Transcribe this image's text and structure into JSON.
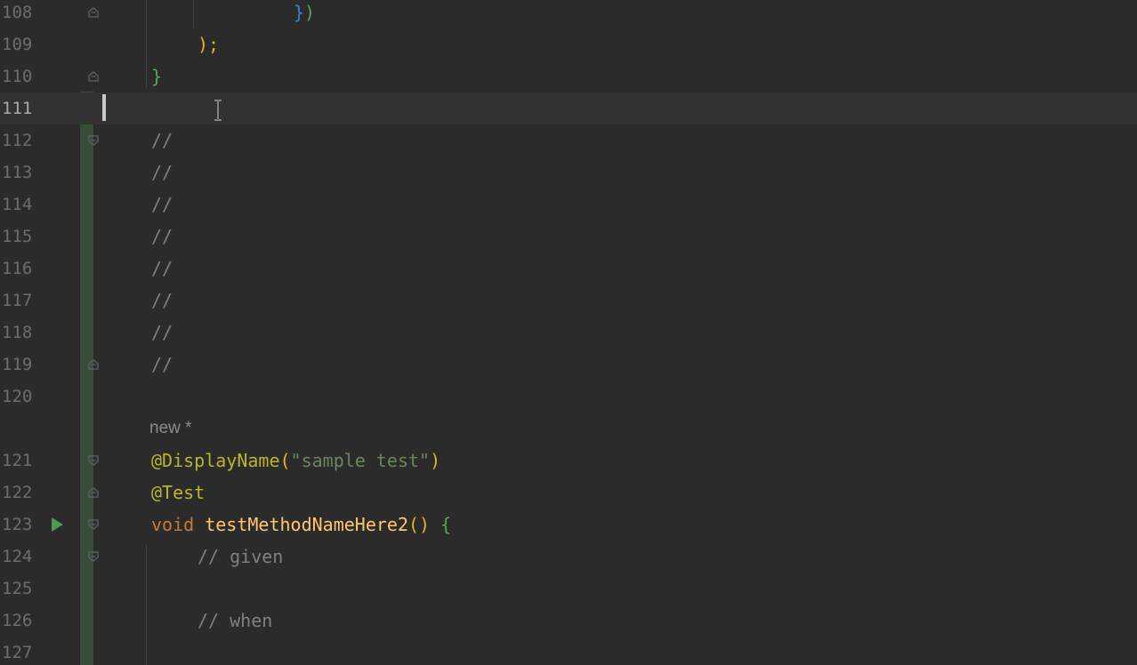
{
  "editor": {
    "lines": [
      {
        "num": "108",
        "tokens": [
          {
            "t": "}",
            "c": "c-brace-b"
          },
          {
            "t": ")",
            "c": "c-brace-g"
          }
        ],
        "indent": 330,
        "fold": "end"
      },
      {
        "num": "109",
        "tokens": [
          {
            "t": ");",
            "c": "c-paren-y"
          }
        ],
        "indent": 222,
        "fold": ""
      },
      {
        "num": "110",
        "tokens": [
          {
            "t": "}",
            "c": "c-brace-g"
          }
        ],
        "indent": 170,
        "fold": "end"
      },
      {
        "num": "111",
        "tokens": [],
        "indent": 170,
        "fold": "",
        "current": true
      },
      {
        "num": "112",
        "tokens": [
          {
            "t": "//",
            "c": "c-comment"
          }
        ],
        "indent": 170,
        "fold": "start"
      },
      {
        "num": "113",
        "tokens": [
          {
            "t": "//",
            "c": "c-comment"
          }
        ],
        "indent": 170,
        "fold": ""
      },
      {
        "num": "114",
        "tokens": [
          {
            "t": "//",
            "c": "c-comment"
          }
        ],
        "indent": 170,
        "fold": ""
      },
      {
        "num": "115",
        "tokens": [
          {
            "t": "//",
            "c": "c-comment"
          }
        ],
        "indent": 170,
        "fold": ""
      },
      {
        "num": "116",
        "tokens": [
          {
            "t": "//",
            "c": "c-comment"
          }
        ],
        "indent": 170,
        "fold": ""
      },
      {
        "num": "117",
        "tokens": [
          {
            "t": "//",
            "c": "c-comment"
          }
        ],
        "indent": 170,
        "fold": ""
      },
      {
        "num": "118",
        "tokens": [
          {
            "t": "//",
            "c": "c-comment"
          }
        ],
        "indent": 170,
        "fold": ""
      },
      {
        "num": "119",
        "tokens": [
          {
            "t": "//",
            "c": "c-comment"
          }
        ],
        "indent": 170,
        "fold": "end"
      },
      {
        "num": "120",
        "tokens": [],
        "indent": 170,
        "fold": ""
      },
      {
        "num": "121",
        "tokens": [
          {
            "t": "@DisplayName",
            "c": "c-anno"
          },
          {
            "t": "(",
            "c": "c-paren-y"
          },
          {
            "t": "\"sample test\"",
            "c": "c-string"
          },
          {
            "t": ")",
            "c": "c-paren-y"
          }
        ],
        "indent": 170,
        "fold": "start"
      },
      {
        "num": "122",
        "tokens": [
          {
            "t": "@Test",
            "c": "c-anno"
          }
        ],
        "indent": 170,
        "fold": "end"
      },
      {
        "num": "123",
        "tokens": [
          {
            "t": "void ",
            "c": "c-kw"
          },
          {
            "t": "testMethodNameHere2",
            "c": "c-method"
          },
          {
            "t": "() ",
            "c": "c-paren-y"
          },
          {
            "t": "{",
            "c": "c-brace-g"
          }
        ],
        "indent": 170,
        "fold": "start",
        "run": true
      },
      {
        "num": "124",
        "tokens": [
          {
            "t": "// given",
            "c": "c-comment"
          }
        ],
        "indent": 222,
        "fold": "start"
      },
      {
        "num": "125",
        "tokens": [],
        "indent": 222,
        "fold": ""
      },
      {
        "num": "126",
        "tokens": [
          {
            "t": "// when",
            "c": "c-comment"
          }
        ],
        "indent": 222,
        "fold": ""
      },
      {
        "num": "127",
        "tokens": [],
        "indent": 222,
        "fold": ""
      }
    ],
    "inlay_hint": "new *"
  },
  "icons": {
    "run": "run-test-icon",
    "fold": "fold-marker-icon",
    "cursor": "text-cursor-icon"
  },
  "colors": {
    "background": "#2b2b2c",
    "current_line": "#323232",
    "vcs_added": "#384d37",
    "comment": "#808080",
    "annotation": "#bbb529",
    "string": "#6a8759",
    "keyword": "#cc7832",
    "method": "#ffc66d"
  }
}
